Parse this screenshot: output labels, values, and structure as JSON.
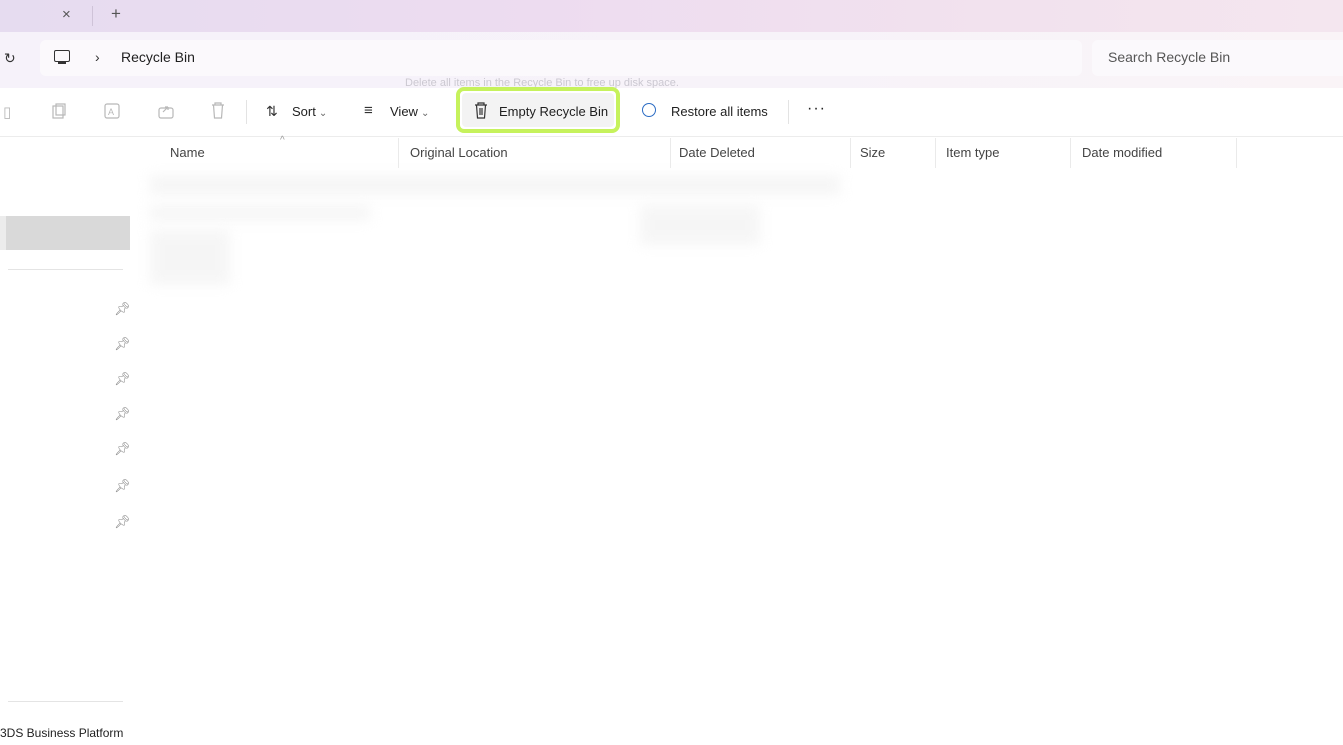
{
  "tabs": {
    "close_glyph": "×",
    "new_glyph": "+"
  },
  "address": {
    "refresh_glyph": "↻",
    "separator": "›",
    "location": "Recycle Bin",
    "search_placeholder": "Search Recycle Bin",
    "tooltip": "Delete all items in the Recycle Bin to free up disk space."
  },
  "toolbar": {
    "sort_label": "Sort",
    "view_label": "View",
    "empty_bin_label": "Empty Recycle Bin",
    "restore_label": "Restore all items",
    "more_label": "···",
    "highlight_color": "#c6f25c"
  },
  "columns": [
    "Name",
    "Original Location",
    "Date Deleted",
    "Size",
    "Item type",
    "Date modified"
  ],
  "sidebar": {
    "bottom_item": "3DS Business Platform"
  }
}
